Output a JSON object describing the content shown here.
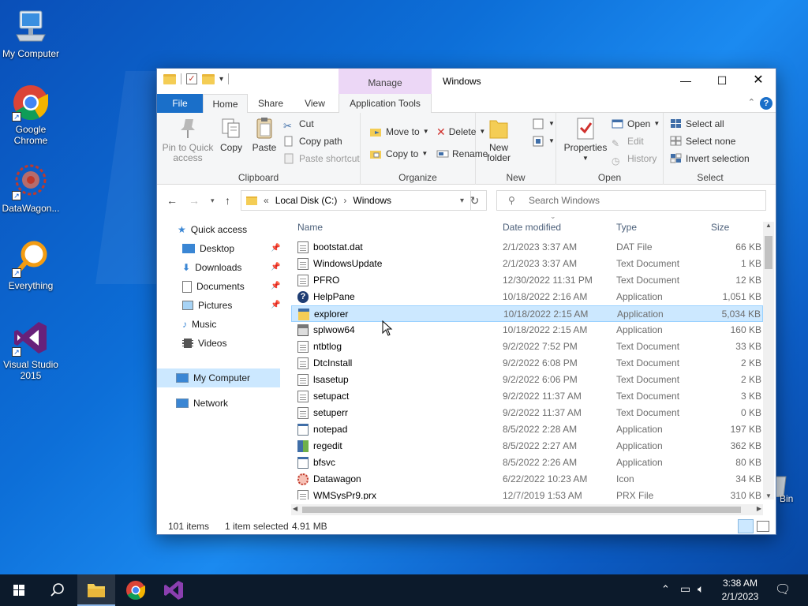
{
  "desktop": {
    "icons": [
      {
        "label": "My Computer"
      },
      {
        "label": "Google Chrome"
      },
      {
        "label": "DataWagon..."
      },
      {
        "label": "Everything"
      },
      {
        "label": "Visual Studio 2015"
      }
    ],
    "recycle_partial": "Bin"
  },
  "window": {
    "title": "Windows",
    "manage_label": "Manage",
    "tabs": {
      "file": "File",
      "home": "Home",
      "share": "Share",
      "view": "View",
      "apptools": "Application Tools"
    },
    "ribbon": {
      "clipboard": {
        "group": "Clipboard",
        "pin": "Pin to Quick access",
        "copy": "Copy",
        "paste": "Paste",
        "cut": "Cut",
        "copy_path": "Copy path",
        "paste_shortcut": "Paste shortcut"
      },
      "organize": {
        "group": "Organize",
        "move_to": "Move to",
        "copy_to": "Copy to",
        "delete": "Delete",
        "rename": "Rename"
      },
      "new": {
        "group": "New",
        "new_folder": "New folder"
      },
      "open": {
        "group": "Open",
        "properties": "Properties",
        "open": "Open",
        "edit": "Edit",
        "history": "History"
      },
      "select": {
        "group": "Select",
        "select_all": "Select all",
        "select_none": "Select none",
        "invert": "Invert selection"
      }
    },
    "address": {
      "crumbs": [
        "Local Disk (C:)",
        "Windows"
      ],
      "prefix": "«"
    },
    "search_placeholder": "Search Windows",
    "nav": {
      "quick_access": "Quick access",
      "desktop": "Desktop",
      "downloads": "Downloads",
      "documents": "Documents",
      "pictures": "Pictures",
      "music": "Music",
      "videos": "Videos",
      "my_computer": "My Computer",
      "network": "Network"
    },
    "columns": {
      "name": "Name",
      "date": "Date modified",
      "type": "Type",
      "size": "Size"
    },
    "files": [
      {
        "name": "bootstat.dat",
        "date": "2/1/2023 3:37 AM",
        "type": "DAT File",
        "size": "66 KB",
        "icon": "doc-icon"
      },
      {
        "name": "WindowsUpdate",
        "date": "2/1/2023 3:37 AM",
        "type": "Text Document",
        "size": "1 KB",
        "icon": "doc-icon"
      },
      {
        "name": "PFRO",
        "date": "12/30/2022 11:31 PM",
        "type": "Text Document",
        "size": "12 KB",
        "icon": "doc-icon"
      },
      {
        "name": "HelpPane",
        "date": "10/18/2022 2:16 AM",
        "type": "Application",
        "size": "1,051 KB",
        "icon": "help-icon"
      },
      {
        "name": "explorer",
        "date": "10/18/2022 2:15 AM",
        "type": "Application",
        "size": "5,034 KB",
        "icon": "folder-app-icon"
      },
      {
        "name": "splwow64",
        "date": "10/18/2022 2:15 AM",
        "type": "Application",
        "size": "160 KB",
        "icon": "printer-icon"
      },
      {
        "name": "ntbtlog",
        "date": "9/2/2022 7:52 PM",
        "type": "Text Document",
        "size": "33 KB",
        "icon": "doc-icon"
      },
      {
        "name": "DtcInstall",
        "date": "9/2/2022 6:08 PM",
        "type": "Text Document",
        "size": "2 KB",
        "icon": "doc-icon"
      },
      {
        "name": "lsasetup",
        "date": "9/2/2022 6:06 PM",
        "type": "Text Document",
        "size": "2 KB",
        "icon": "doc-icon"
      },
      {
        "name": "setupact",
        "date": "9/2/2022 11:37 AM",
        "type": "Text Document",
        "size": "3 KB",
        "icon": "doc-icon"
      },
      {
        "name": "setuperr",
        "date": "9/2/2022 11:37 AM",
        "type": "Text Document",
        "size": "0 KB",
        "icon": "doc-icon"
      },
      {
        "name": "notepad",
        "date": "8/5/2022 2:28 AM",
        "type": "Application",
        "size": "197 KB",
        "icon": "app-icon"
      },
      {
        "name": "regedit",
        "date": "8/5/2022 2:27 AM",
        "type": "Application",
        "size": "362 KB",
        "icon": "regedit-icon"
      },
      {
        "name": "bfsvc",
        "date": "8/5/2022 2:26 AM",
        "type": "Application",
        "size": "80 KB",
        "icon": "app-icon"
      },
      {
        "name": "Datawagon",
        "date": "6/22/2022 10:23 AM",
        "type": "Icon",
        "size": "34 KB",
        "icon": "datawagon-icon"
      },
      {
        "name": "WMSysPr9.prx",
        "date": "12/7/2019 1:53 AM",
        "type": "PRX File",
        "size": "310 KB",
        "icon": "doc-icon"
      }
    ],
    "selected_index": 4,
    "status": {
      "items": "101 items",
      "selected": "1 item selected",
      "size": "4.91 MB"
    }
  },
  "taskbar": {
    "clock_time": "3:38 AM",
    "clock_date": "2/1/2023"
  },
  "colors": {
    "accent": "#1a6fc9",
    "selection": "#cce8ff",
    "manage_tab": "#ecd7f6",
    "taskbar": "#0c1a2b"
  }
}
